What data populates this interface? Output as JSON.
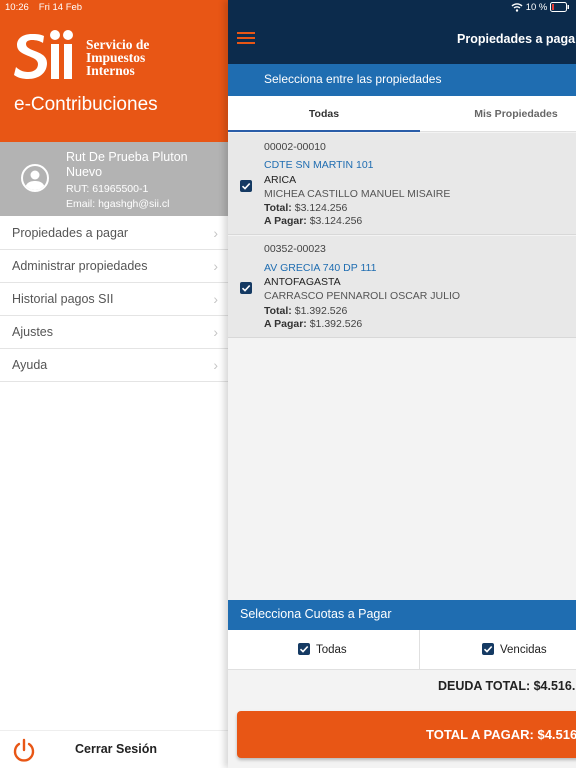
{
  "status_bar": {
    "time": "10:26",
    "date": "Fri 14 Feb",
    "battery": "10 %"
  },
  "brand": {
    "logo_mark": "Sii",
    "logo_line1": "Servicio de",
    "logo_line2": "Impuestos",
    "logo_line3": "Internos",
    "app_name": "e-Contribuciones",
    "accent": "#e85615",
    "navy": "#0c2b4c",
    "blue": "#1f6db1"
  },
  "user": {
    "name": "Rut De Prueba Pluton Nuevo",
    "rut": "RUT: 61965500-1",
    "email": "Email: hgashgh@sii.cl"
  },
  "menu": [
    {
      "label": "Propiedades a pagar"
    },
    {
      "label": "Administrar propiedades"
    },
    {
      "label": "Historial pagos SII"
    },
    {
      "label": "Ajustes"
    },
    {
      "label": "Ayuda"
    }
  ],
  "logout_label": "Cerrar Sesión",
  "nav_title": "Propiedades a pagar",
  "select_label": "Selecciona entre las propiedades",
  "tabs": [
    {
      "label": "Todas",
      "active": true
    },
    {
      "label": "Mis Propiedades",
      "active": false
    }
  ],
  "properties": [
    {
      "code": "00002-00010",
      "address": "CDTE SN MARTIN 101",
      "commune": "ARICA",
      "owner": "MICHEA CASTILLO MANUEL MISAIRE",
      "total_label": "Total:",
      "total": "$3.124.256",
      "apagar_label": "A Pagar:",
      "apagar": "$3.124.256",
      "checked": true
    },
    {
      "code": "00352-00023",
      "address": "AV GRECIA 740 DP 111",
      "commune": "ANTOFAGASTA",
      "owner": "CARRASCO PENNAROLI OSCAR JULIO",
      "total_label": "Total:",
      "total": "$1.392.526",
      "apagar_label": "A Pagar:",
      "apagar": "$1.392.526",
      "checked": true
    }
  ],
  "cuotas": {
    "title": "Selecciona Cuotas a Pagar",
    "options": [
      {
        "label": "Todas",
        "checked": true
      },
      {
        "label": "Vencidas",
        "checked": true
      }
    ]
  },
  "deuda_total": "DEUDA TOTAL: $4.516.",
  "pay_button": "TOTAL A PAGAR: $4.516"
}
